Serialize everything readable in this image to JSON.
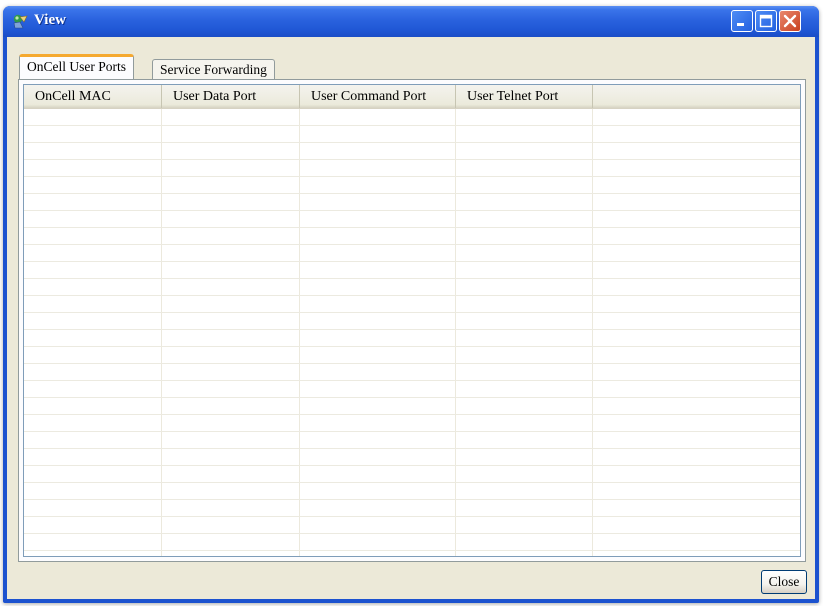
{
  "window": {
    "title": "View",
    "icon": "app-icon",
    "controls": {
      "minimize": "minimize-icon",
      "maximize": "maximize-icon",
      "close": "close-icon"
    }
  },
  "tabs": [
    {
      "label": "OnCell User Ports",
      "active": true
    },
    {
      "label": "Service Forwarding",
      "active": false
    }
  ],
  "table": {
    "columns": [
      {
        "label": "OnCell MAC"
      },
      {
        "label": "User Data Port"
      },
      {
        "label": "User Command Port"
      },
      {
        "label": "User Telnet Port"
      }
    ],
    "rows": []
  },
  "footer": {
    "close_label": "Close"
  },
  "colors": {
    "titlebar": "#1f56d4",
    "dialog_face": "#ece9d8",
    "active_tab_accent": "#f5a930",
    "close_control": "#c8401f"
  }
}
